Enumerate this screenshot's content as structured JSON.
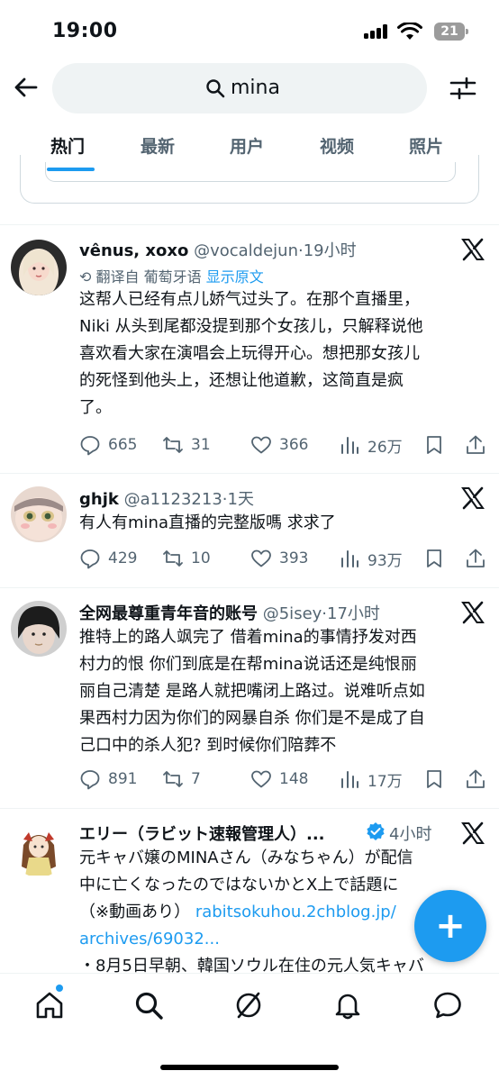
{
  "status": {
    "time": "19:00",
    "battery": "21"
  },
  "search": {
    "query": "mina"
  },
  "tabs": [
    {
      "label": "热门"
    },
    {
      "label": "最新"
    },
    {
      "label": "用户"
    },
    {
      "label": "视频"
    },
    {
      "label": "照片"
    }
  ],
  "posts": [
    {
      "name": "vênus, xoxo",
      "handle": "@vocaldejun",
      "time": "·19小时",
      "translate_label": "翻译自 葡萄牙语",
      "translate_link": "显示原文",
      "lines": [
        "这帮人已经有点儿娇气过头了。在那个直播里，",
        "Niki 从头到尾都没提到那个女孩儿，只解释说他",
        "喜欢看大家在演唱会上玩得开心。想把那女孩儿",
        "的死怪到他头上，还想让他道歉，这简直是疯",
        "了。"
      ],
      "replies": "665",
      "reposts": "31",
      "likes": "366",
      "views": "26万"
    },
    {
      "name": "ghjk",
      "handle": "@a1123213",
      "time": "·1天",
      "lines": [
        "有人有mina直播的完整版嗎 求求了"
      ],
      "replies": "429",
      "reposts": "10",
      "likes": "393",
      "views": "93万"
    },
    {
      "name": "全网最尊重青年音的账号",
      "handle": "@5isey",
      "time": "·17小时",
      "lines": [
        "推特上的路人飒完了 借着mina的事情抒发对西",
        "村力的恨 你们到底是在帮mina说话还是纯恨丽",
        "丽自己清楚 是路人就把嘴闭上路过。说难听点如",
        "果西村力因为你们的网暴自杀 你们是不是成了自",
        "己口中的杀人犯? 到时候你们陪葬不"
      ],
      "replies": "891",
      "reposts": "7",
      "likes": "148",
      "views": "17万"
    },
    {
      "name": "エリー（ラビット速報管理人）...",
      "handle": "",
      "time": "4小时",
      "lines": [
        "元キャバ嬢のMINAさん（みなちゃん）が配信",
        "中に亡くなったのではないかとX上で話題に",
        "（※動画あり）",
        "・8月5日早朝、韓国ソウル在住の元人気キャバ"
      ],
      "link1": "rabitsokuhou.2chblog.jp/",
      "link2": "archives/69032..."
    }
  ],
  "colors": {
    "accent": "#1d9bf0",
    "muted": "#536471",
    "text": "#0f1419"
  }
}
